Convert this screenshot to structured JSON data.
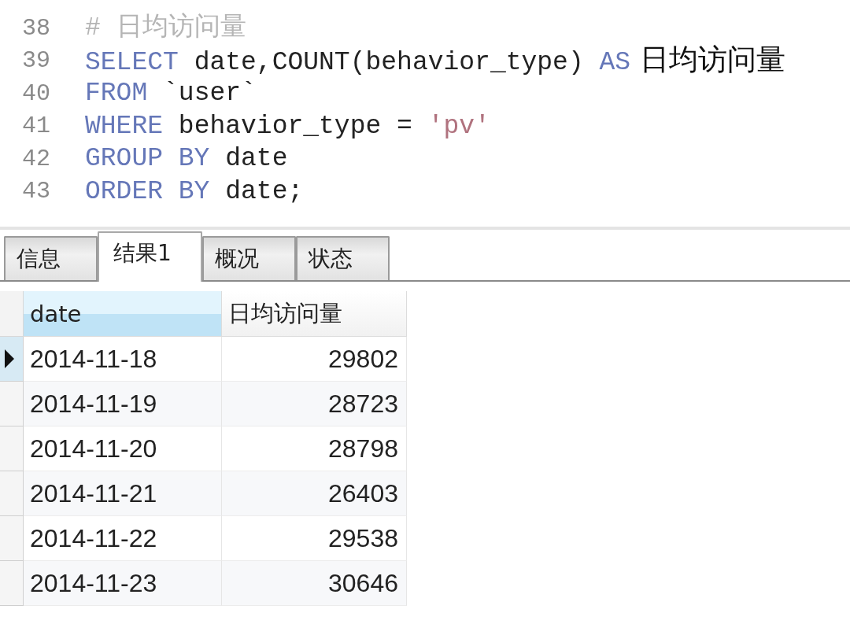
{
  "editor": {
    "lines": [
      {
        "number": "38",
        "tokens": [
          {
            "kind": "comment",
            "text": "# 日均访问量"
          }
        ]
      },
      {
        "number": "39",
        "tokens": [
          {
            "kind": "keyword",
            "text": "SELECT"
          },
          {
            "kind": "plain",
            "text": " date,COUNT(behavior_type) "
          },
          {
            "kind": "keyword",
            "text": "AS"
          },
          {
            "kind": "alias",
            "text": " 日均访问量"
          }
        ]
      },
      {
        "number": "40",
        "tokens": [
          {
            "kind": "keyword",
            "text": "FROM"
          },
          {
            "kind": "plain",
            "text": " `user`"
          }
        ]
      },
      {
        "number": "41",
        "tokens": [
          {
            "kind": "keyword",
            "text": "WHERE"
          },
          {
            "kind": "plain",
            "text": " behavior_type = "
          },
          {
            "kind": "string",
            "text": "'pv'"
          }
        ]
      },
      {
        "number": "42",
        "tokens": [
          {
            "kind": "keyword",
            "text": "GROUP BY"
          },
          {
            "kind": "plain",
            "text": " date"
          }
        ]
      },
      {
        "number": "43",
        "tokens": [
          {
            "kind": "keyword",
            "text": "ORDER BY"
          },
          {
            "kind": "plain",
            "text": " date;"
          }
        ]
      }
    ]
  },
  "tabs": [
    {
      "label": "信息",
      "selected": false
    },
    {
      "label": "结果1",
      "selected": true
    },
    {
      "label": "概况",
      "selected": false
    },
    {
      "label": "状态",
      "selected": false
    }
  ],
  "table": {
    "columns": [
      {
        "label": "date",
        "kind": "text",
        "selected": true
      },
      {
        "label": "日均访问量",
        "kind": "number",
        "selected": false
      }
    ],
    "rows": [
      {
        "selected": true,
        "cells": [
          "2014-11-18",
          "29802"
        ]
      },
      {
        "selected": false,
        "cells": [
          "2014-11-19",
          "28723"
        ]
      },
      {
        "selected": false,
        "cells": [
          "2014-11-20",
          "28798"
        ]
      },
      {
        "selected": false,
        "cells": [
          "2014-11-21",
          "26403"
        ]
      },
      {
        "selected": false,
        "cells": [
          "2014-11-22",
          "29538"
        ]
      },
      {
        "selected": false,
        "cells": [
          "2014-11-23",
          "30646"
        ]
      }
    ]
  }
}
